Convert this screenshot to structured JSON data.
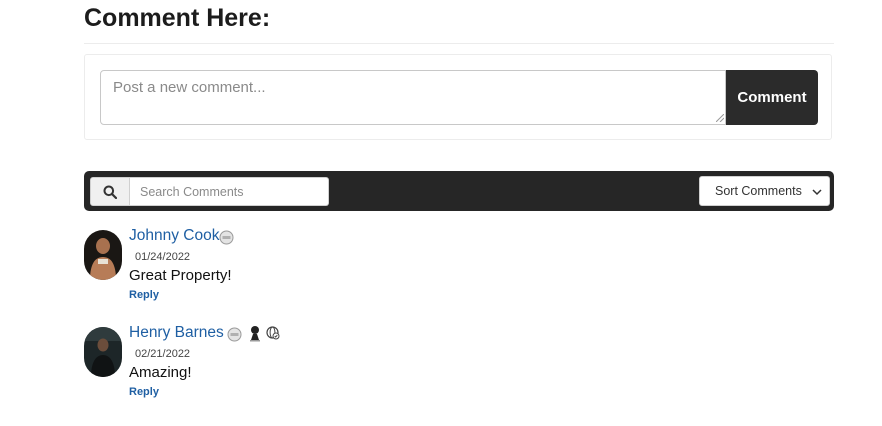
{
  "heading": "Comment Here:",
  "compose": {
    "placeholder": "Post a new comment...",
    "button_label": "Comment"
  },
  "toolbar": {
    "search_placeholder": "Search Comments",
    "sort_label": "Sort Comments"
  },
  "comments": [
    {
      "name": "Johnny Cook",
      "date": "01/24/2022",
      "text": "Great Property!",
      "reply_label": "Reply",
      "badges": [
        "level-badge-icon"
      ]
    },
    {
      "name": "Henry Barnes",
      "date": "02/21/2022",
      "text": "Amazing!",
      "reply_label": "Reply",
      "badges": [
        "level-badge-icon",
        "award-figure-icon",
        "globe-check-icon"
      ]
    }
  ],
  "colors": {
    "accent_link": "#1f5fa3",
    "toolbar_bg": "#262626",
    "button_bg": "#2b2b2b"
  }
}
